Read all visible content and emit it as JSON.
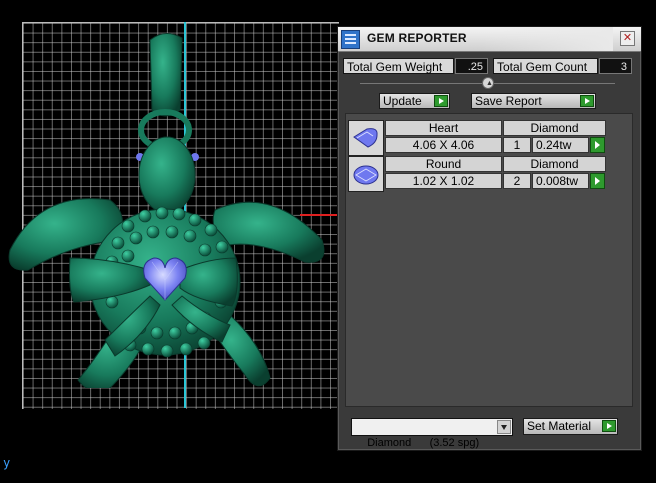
{
  "viewport": {
    "colors": {
      "grid": "#c8c8c8",
      "axis_vertical": "#2bc6d6",
      "axis_horizontal": "#e02020",
      "model_body": "#1f8a68",
      "gem": "#6f78ef"
    },
    "axis_glyph": "y"
  },
  "panel": {
    "title": "GEM REPORTER",
    "close_symbol": "✕",
    "total_weight_label": "Total Gem Weight",
    "total_weight_value": ".25",
    "total_count_label": "Total Gem Count",
    "total_count_value": "3",
    "update_label": "Update",
    "save_report_label": "Save Report",
    "gems": [
      {
        "shape": "Heart",
        "material": "Diamond",
        "size": "4.06 X 4.06",
        "count": "1",
        "weight": "0.24tw",
        "icon": "heart-gem-icon"
      },
      {
        "shape": "Round",
        "material": "Diamond",
        "size": "1.02 X 1.02",
        "count": "2",
        "weight": "0.008tw",
        "icon": "round-gem-icon"
      }
    ],
    "material_select": "Diamond      (3.52 spg)",
    "set_material_label": "Set Material"
  }
}
